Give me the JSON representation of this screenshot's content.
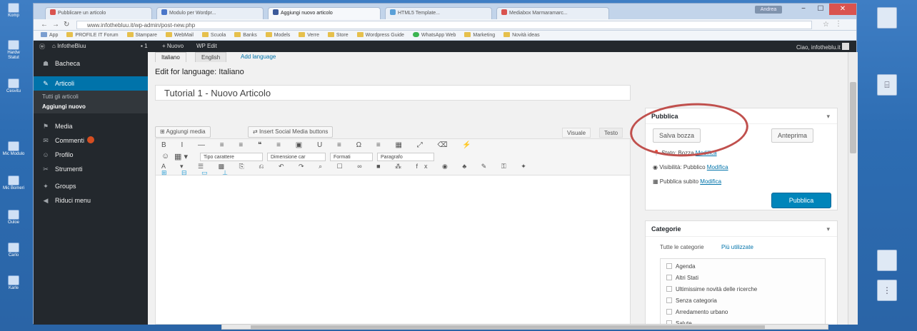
{
  "desktop": {
    "left_icons": [
      "Komp",
      "Hardw Statut",
      "Cesvitu",
      "Mic Modulo",
      "Mic Bomeri",
      "Ouloe",
      "Carlo",
      "Karle"
    ]
  },
  "browser": {
    "tabs": [
      {
        "label": "Pubblicare un articolo",
        "color": "#d9534f"
      },
      {
        "label": "Modulo per Wordpr...",
        "color": "#4a76c9"
      },
      {
        "label": "Aggiungi nuovo articolo",
        "color": "#3c5a9a"
      },
      {
        "label": "HTML5 Template...",
        "color": "#5aa0d8"
      },
      {
        "label": "Mediabox Marmaramarc...",
        "color": "#d9534f"
      }
    ],
    "user_label": "Andrea",
    "window_controls": [
      "−",
      "☐",
      "✕"
    ],
    "url": "www.infothebluu.it/wp-admin/post-new.php",
    "bookmarks": [
      "App",
      "PROFILE IT Forum",
      "Stampare",
      "WebMail",
      "Scuola",
      "Banks",
      "Models",
      "Verre",
      "Store",
      "Wordpress Guide",
      "WhatsApp Web",
      "Marketing",
      "Novità ideas"
    ]
  },
  "adminbar": {
    "items": [
      "InfotheBluu",
      "1",
      "+ Nuovo",
      "WP Edit"
    ],
    "howdy": "Ciao, infotheblu.it"
  },
  "sidebar": {
    "items": [
      {
        "label": "Bacheca",
        "icon": "☗"
      },
      {
        "label": "Articoli",
        "icon": "✎"
      },
      {
        "label": "Media",
        "icon": "⚑"
      },
      {
        "label": "Commenti",
        "icon": "✉"
      },
      {
        "label": "Profilo",
        "icon": "☺"
      },
      {
        "label": "Strumenti",
        "icon": "✂"
      },
      {
        "label": "Groups",
        "icon": "✦"
      },
      {
        "label": "Riduci menu",
        "icon": "◀"
      }
    ],
    "subitems": [
      "Tutti gli articoli",
      "Aggiungi nuovo"
    ]
  },
  "editor": {
    "lang_tabs": [
      "Italiano",
      "English"
    ],
    "add_language": "Add language",
    "heading": "Edit for language: Italiano",
    "title_value": "Tutorial 1 - Nuovo Articolo",
    "media_button": "Aggiungi media",
    "insert_media": "Insert Social Media buttons",
    "view_tabs": [
      "Visuale",
      "Testo"
    ],
    "toolbar_row1": "B I — ≡ ≡ ❝ ≡ ▣ U ≡ Ω ≡ ▦ ⤢ ⌫ ⚡",
    "toolbar_row3": "A ▾ ☰ ▩ ⎘ ⎌ ↶ ↷ ⌕ ☐ ∞ ■ ⁂ fx ◉ ♣ ✎ ⚿ ✦",
    "toolbar_row4": "⊞ ⊟ ▭ ⊥",
    "font_family": "Tipo carattere",
    "font_size": "Dimensione car",
    "format": "Formati",
    "paragraph": "Paragrafo"
  },
  "publish": {
    "title": "Pubblica",
    "save_draft": "Salva bozza",
    "preview": "Anteprima",
    "status": "Stato: Bozza",
    "status_link": "Modifica",
    "visibility": "Visibilità: Pubblico",
    "visibility_link": "Modifica",
    "schedule": "Pubblica subito",
    "schedule_link": "Modifica",
    "publish_button": "Pubblica"
  },
  "categories": {
    "title": "Categorie",
    "tabs": [
      "Tutte le categorie",
      "Più utilizzate"
    ],
    "items": [
      "Agenda",
      "Altri Stati",
      "Ultimissime novità delle ricerche",
      "Senza categoria",
      "Arredamento urbano",
      "Salute"
    ]
  }
}
